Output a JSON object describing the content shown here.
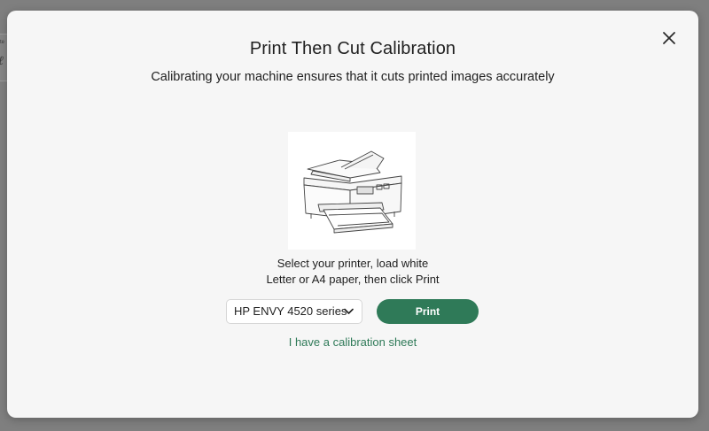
{
  "dialog": {
    "title": "Print Then Cut Calibration",
    "subtitle": "Calibrating your machine ensures that it cuts printed images accurately",
    "close_icon": "close-icon",
    "image_icon": "printer-illustration",
    "instructions_line1": "Select your printer, load white",
    "instructions_line2": "Letter or A4 paper, then click Print",
    "printer_select": {
      "selected": "HP ENVY 4520 series",
      "icon": "chevron-down-icon"
    },
    "print_label": "Print",
    "calibration_link": "I have a calibration sheet"
  },
  "colors": {
    "accent": "#2f7a58",
    "backdrop": "#7f7f7f",
    "dialog_bg": "#f6f6f6"
  }
}
